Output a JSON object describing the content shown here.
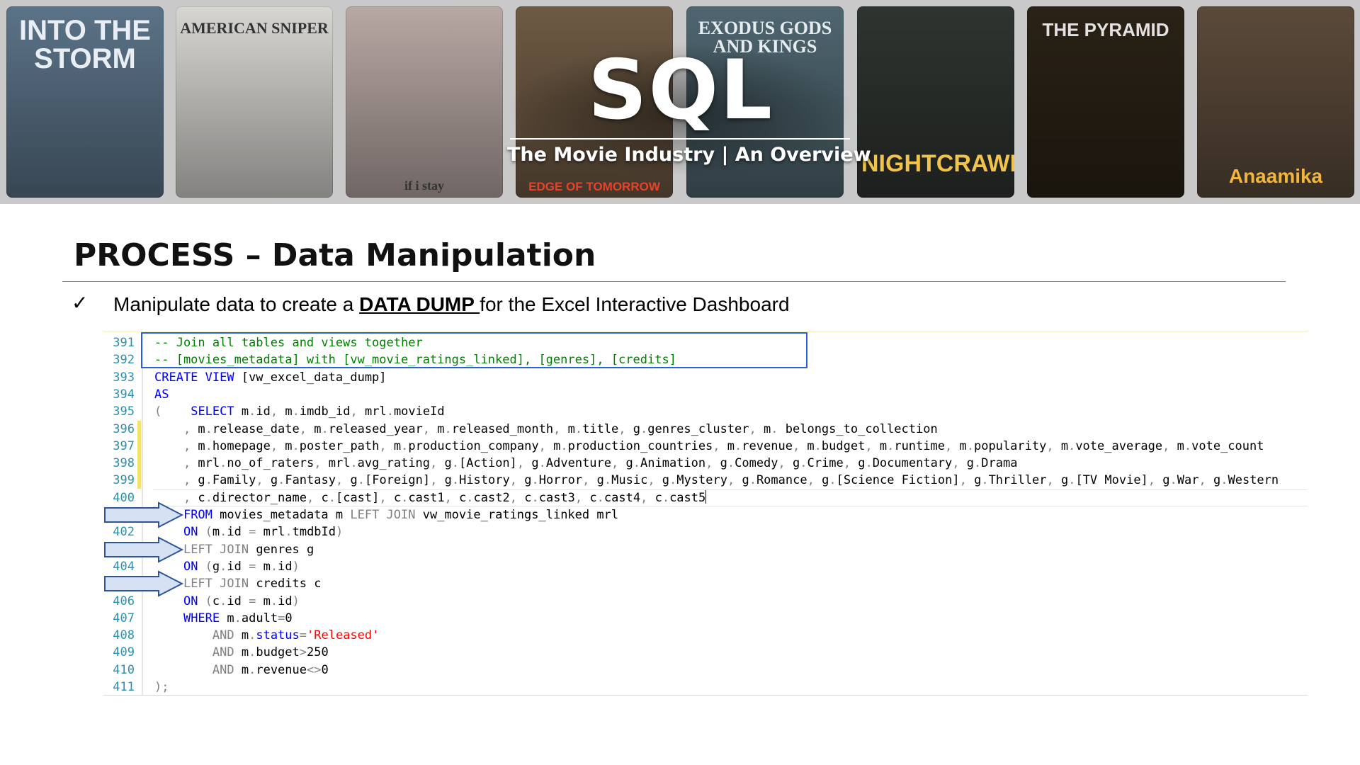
{
  "banner": {
    "title": "SQL",
    "subtitle": "The Movie Industry | An Overview",
    "posters": [
      {
        "name": "INTO THE STORM",
        "color": "#5b7388"
      },
      {
        "name": "AMERICAN SNIPER",
        "color": "#d8d6d2"
      },
      {
        "name": "if i stay",
        "color": "#b8a8a4"
      },
      {
        "name": "EDGE OF TOMORROW",
        "color": "#6e5a44"
      },
      {
        "name": "EXODUS GODS AND KINGS",
        "color": "#4f6670"
      },
      {
        "name": "NIGHTCRAWLER",
        "color": "#2f3430"
      },
      {
        "name": "THE PYRAMID",
        "color": "#2a2216"
      },
      {
        "name": "Anaamika",
        "color": "#5b4a3a"
      }
    ]
  },
  "slide": {
    "title": "PROCESS – Data Manipulation",
    "bullet_mark": "✓",
    "bullet_pre": "Manipulate data to create a ",
    "bullet_em": "DATA DUMP ",
    "bullet_post": "for the Excel Interactive Dashboard"
  },
  "code_lines": [
    {
      "n": "391",
      "seg": [
        [
          "-- Join all tables and views together",
          "cm"
        ]
      ]
    },
    {
      "n": "392",
      "seg": [
        [
          "-- [movies_metadata] with [vw_movie_ratings_linked], [genres], [credits]",
          "cm"
        ]
      ]
    },
    {
      "n": "393",
      "seg": [
        [
          "CREATE VIEW ",
          "k"
        ],
        [
          "[vw_excel_data_dump]",
          ""
        ]
      ]
    },
    {
      "n": "394",
      "seg": [
        [
          "AS",
          "k"
        ]
      ]
    },
    {
      "n": "395",
      "seg": [
        [
          "(",
          "gr"
        ],
        [
          "    ",
          ""
        ],
        [
          "SELECT ",
          "k"
        ],
        [
          "m",
          ""
        ],
        [
          ".",
          "gr"
        ],
        [
          "id",
          ""
        ],
        [
          ", ",
          "gr"
        ],
        [
          "m",
          ""
        ],
        [
          ".",
          "gr"
        ],
        [
          "imdb_id",
          ""
        ],
        [
          ", ",
          "gr"
        ],
        [
          "mrl",
          ""
        ],
        [
          ".",
          "gr"
        ],
        [
          "movieId",
          ""
        ]
      ]
    },
    {
      "n": "396",
      "seg": [
        [
          "    , ",
          "gr"
        ],
        [
          "m",
          ""
        ],
        [
          ".",
          "gr"
        ],
        [
          "release_date",
          ""
        ],
        [
          ", ",
          "gr"
        ],
        [
          "m",
          ""
        ],
        [
          ".",
          "gr"
        ],
        [
          "released_year",
          ""
        ],
        [
          ", ",
          "gr"
        ],
        [
          "m",
          ""
        ],
        [
          ".",
          "gr"
        ],
        [
          "released_month",
          ""
        ],
        [
          ", ",
          "gr"
        ],
        [
          "m",
          ""
        ],
        [
          ".",
          "gr"
        ],
        [
          "title",
          ""
        ],
        [
          ", ",
          "gr"
        ],
        [
          "g",
          ""
        ],
        [
          ".",
          "gr"
        ],
        [
          "genres_cluster",
          ""
        ],
        [
          ", ",
          "gr"
        ],
        [
          "m",
          ""
        ],
        [
          ". ",
          "gr"
        ],
        [
          "belongs_to_collection",
          ""
        ]
      ]
    },
    {
      "n": "397",
      "seg": [
        [
          "    , ",
          "gr"
        ],
        [
          "m",
          ""
        ],
        [
          ".",
          "gr"
        ],
        [
          "homepage",
          ""
        ],
        [
          ", ",
          "gr"
        ],
        [
          "m",
          ""
        ],
        [
          ".",
          "gr"
        ],
        [
          "poster_path",
          ""
        ],
        [
          ", ",
          "gr"
        ],
        [
          "m",
          ""
        ],
        [
          ".",
          "gr"
        ],
        [
          "production_company",
          ""
        ],
        [
          ", ",
          "gr"
        ],
        [
          "m",
          ""
        ],
        [
          ".",
          "gr"
        ],
        [
          "production_countries",
          ""
        ],
        [
          ", ",
          "gr"
        ],
        [
          "m",
          ""
        ],
        [
          ".",
          "gr"
        ],
        [
          "revenue",
          ""
        ],
        [
          ", ",
          "gr"
        ],
        [
          "m",
          ""
        ],
        [
          ".",
          "gr"
        ],
        [
          "budget",
          ""
        ],
        [
          ", ",
          "gr"
        ],
        [
          "m",
          ""
        ],
        [
          ".",
          "gr"
        ],
        [
          "runtime",
          ""
        ],
        [
          ", ",
          "gr"
        ],
        [
          "m",
          ""
        ],
        [
          ".",
          "gr"
        ],
        [
          "popularity",
          ""
        ],
        [
          ", ",
          "gr"
        ],
        [
          "m",
          ""
        ],
        [
          ".",
          "gr"
        ],
        [
          "vote_average",
          ""
        ],
        [
          ", ",
          "gr"
        ],
        [
          "m",
          ""
        ],
        [
          ".",
          "gr"
        ],
        [
          "vote_count",
          ""
        ]
      ]
    },
    {
      "n": "398",
      "seg": [
        [
          "    , ",
          "gr"
        ],
        [
          "mrl",
          ""
        ],
        [
          ".",
          "gr"
        ],
        [
          "no_of_raters",
          ""
        ],
        [
          ", ",
          "gr"
        ],
        [
          "mrl",
          ""
        ],
        [
          ".",
          "gr"
        ],
        [
          "avg_rating",
          ""
        ],
        [
          ", ",
          "gr"
        ],
        [
          "g",
          ""
        ],
        [
          ".",
          "gr"
        ],
        [
          "[Action]",
          ""
        ],
        [
          ", ",
          "gr"
        ],
        [
          "g",
          ""
        ],
        [
          ".",
          "gr"
        ],
        [
          "Adventure",
          ""
        ],
        [
          ", ",
          "gr"
        ],
        [
          "g",
          ""
        ],
        [
          ".",
          "gr"
        ],
        [
          "Animation",
          ""
        ],
        [
          ", ",
          "gr"
        ],
        [
          "g",
          ""
        ],
        [
          ".",
          "gr"
        ],
        [
          "Comedy",
          ""
        ],
        [
          ", ",
          "gr"
        ],
        [
          "g",
          ""
        ],
        [
          ".",
          "gr"
        ],
        [
          "Crime",
          ""
        ],
        [
          ", ",
          "gr"
        ],
        [
          "g",
          ""
        ],
        [
          ".",
          "gr"
        ],
        [
          "Documentary",
          ""
        ],
        [
          ", ",
          "gr"
        ],
        [
          "g",
          ""
        ],
        [
          ".",
          "gr"
        ],
        [
          "Drama",
          ""
        ]
      ]
    },
    {
      "n": "399",
      "seg": [
        [
          "    , ",
          "gr"
        ],
        [
          "g",
          ""
        ],
        [
          ".",
          "gr"
        ],
        [
          "Family",
          ""
        ],
        [
          ", ",
          "gr"
        ],
        [
          "g",
          ""
        ],
        [
          ".",
          "gr"
        ],
        [
          "Fantasy",
          ""
        ],
        [
          ", ",
          "gr"
        ],
        [
          "g",
          ""
        ],
        [
          ".",
          "gr"
        ],
        [
          "[Foreign]",
          ""
        ],
        [
          ", ",
          "gr"
        ],
        [
          "g",
          ""
        ],
        [
          ".",
          "gr"
        ],
        [
          "History",
          ""
        ],
        [
          ", ",
          "gr"
        ],
        [
          "g",
          ""
        ],
        [
          ".",
          "gr"
        ],
        [
          "Horror",
          ""
        ],
        [
          ", ",
          "gr"
        ],
        [
          "g",
          ""
        ],
        [
          ".",
          "gr"
        ],
        [
          "Music",
          ""
        ],
        [
          ", ",
          "gr"
        ],
        [
          "g",
          ""
        ],
        [
          ".",
          "gr"
        ],
        [
          "Mystery",
          ""
        ],
        [
          ", ",
          "gr"
        ],
        [
          "g",
          ""
        ],
        [
          ".",
          "gr"
        ],
        [
          "Romance",
          ""
        ],
        [
          ", ",
          "gr"
        ],
        [
          "g",
          ""
        ],
        [
          ".",
          "gr"
        ],
        [
          "[Science Fiction]",
          ""
        ],
        [
          ", ",
          "gr"
        ],
        [
          "g",
          ""
        ],
        [
          ".",
          "gr"
        ],
        [
          "Thriller",
          ""
        ],
        [
          ", ",
          "gr"
        ],
        [
          "g",
          ""
        ],
        [
          ".",
          "gr"
        ],
        [
          "[TV Movie]",
          ""
        ],
        [
          ", ",
          "gr"
        ],
        [
          "g",
          ""
        ],
        [
          ".",
          "gr"
        ],
        [
          "War",
          ""
        ],
        [
          ", ",
          "gr"
        ],
        [
          "g",
          ""
        ],
        [
          ".",
          "gr"
        ],
        [
          "Western",
          ""
        ]
      ]
    },
    {
      "n": "400",
      "seg": [
        [
          "    , ",
          "gr"
        ],
        [
          "c",
          ""
        ],
        [
          ".",
          "gr"
        ],
        [
          "director_name",
          ""
        ],
        [
          ", ",
          "gr"
        ],
        [
          "c",
          ""
        ],
        [
          ".",
          "gr"
        ],
        [
          "[cast]",
          ""
        ],
        [
          ", ",
          "gr"
        ],
        [
          "c",
          ""
        ],
        [
          ".",
          "gr"
        ],
        [
          "cast1",
          ""
        ],
        [
          ", ",
          "gr"
        ],
        [
          "c",
          ""
        ],
        [
          ".",
          "gr"
        ],
        [
          "cast2",
          ""
        ],
        [
          ", ",
          "gr"
        ],
        [
          "c",
          ""
        ],
        [
          ".",
          "gr"
        ],
        [
          "cast3",
          ""
        ],
        [
          ", ",
          "gr"
        ],
        [
          "c",
          ""
        ],
        [
          ".",
          "gr"
        ],
        [
          "cast4",
          ""
        ],
        [
          ", ",
          "gr"
        ],
        [
          "c",
          ""
        ],
        [
          ".",
          "gr"
        ],
        [
          "cast5",
          ""
        ]
      ]
    },
    {
      "n": "",
      "seg": [
        [
          "    ",
          ""
        ],
        [
          "FROM ",
          "k"
        ],
        [
          "movies_metadata m ",
          ""
        ],
        [
          "LEFT JOIN ",
          "gr"
        ],
        [
          "vw_movie_ratings_linked mrl",
          ""
        ]
      ]
    },
    {
      "n": "402",
      "seg": [
        [
          "    ",
          ""
        ],
        [
          "ON ",
          "k"
        ],
        [
          "(",
          "gr"
        ],
        [
          "m",
          ""
        ],
        [
          ".",
          "gr"
        ],
        [
          "id ",
          ""
        ],
        [
          "= ",
          "gr"
        ],
        [
          "mrl",
          ""
        ],
        [
          ".",
          "gr"
        ],
        [
          "tmdbId",
          ""
        ],
        [
          ")",
          "gr"
        ]
      ]
    },
    {
      "n": "",
      "seg": [
        [
          "    ",
          ""
        ],
        [
          "LEFT JOIN ",
          "gr"
        ],
        [
          "genres g",
          ""
        ]
      ]
    },
    {
      "n": "404",
      "seg": [
        [
          "    ",
          ""
        ],
        [
          "ON ",
          "k"
        ],
        [
          "(",
          "gr"
        ],
        [
          "g",
          ""
        ],
        [
          ".",
          "gr"
        ],
        [
          "id ",
          ""
        ],
        [
          "= ",
          "gr"
        ],
        [
          "m",
          ""
        ],
        [
          ".",
          "gr"
        ],
        [
          "id",
          ""
        ],
        [
          ")",
          "gr"
        ]
      ]
    },
    {
      "n": "",
      "seg": [
        [
          "    ",
          ""
        ],
        [
          "LEFT JOIN ",
          "gr"
        ],
        [
          "credits c",
          ""
        ]
      ]
    },
    {
      "n": "406",
      "seg": [
        [
          "    ",
          ""
        ],
        [
          "ON ",
          "k"
        ],
        [
          "(",
          "gr"
        ],
        [
          "c",
          ""
        ],
        [
          ".",
          "gr"
        ],
        [
          "id ",
          ""
        ],
        [
          "= ",
          "gr"
        ],
        [
          "m",
          ""
        ],
        [
          ".",
          "gr"
        ],
        [
          "id",
          ""
        ],
        [
          ")",
          "gr"
        ]
      ]
    },
    {
      "n": "407",
      "seg": [
        [
          "    ",
          ""
        ],
        [
          "WHERE ",
          "k"
        ],
        [
          "m",
          ""
        ],
        [
          ".",
          "gr"
        ],
        [
          "adult",
          ""
        ],
        [
          "=",
          "gr"
        ],
        [
          "0",
          ""
        ]
      ]
    },
    {
      "n": "408",
      "seg": [
        [
          "        ",
          ""
        ],
        [
          "AND ",
          "gr"
        ],
        [
          "m",
          ""
        ],
        [
          ".",
          "gr"
        ],
        [
          "status",
          "k"
        ],
        [
          "=",
          "gr"
        ],
        [
          "'Released'",
          "st"
        ]
      ]
    },
    {
      "n": "409",
      "seg": [
        [
          "        ",
          ""
        ],
        [
          "AND ",
          "gr"
        ],
        [
          "m",
          ""
        ],
        [
          ".",
          "gr"
        ],
        [
          "budget",
          ""
        ],
        [
          ">",
          "gr"
        ],
        [
          "250",
          ""
        ]
      ]
    },
    {
      "n": "410",
      "seg": [
        [
          "        ",
          ""
        ],
        [
          "AND ",
          "gr"
        ],
        [
          "m",
          ""
        ],
        [
          ".",
          "gr"
        ],
        [
          "revenue",
          ""
        ],
        [
          "<>",
          "gr"
        ],
        [
          "0",
          ""
        ]
      ]
    },
    {
      "n": "411",
      "seg": [
        [
          ")",
          "gr"
        ],
        [
          ";",
          "gr"
        ]
      ]
    }
  ],
  "colors": {
    "keyword": "#0000ff",
    "comment": "#008000",
    "string": "#ff0000",
    "operator": "#808080",
    "line_number": "#2b91af",
    "highlight_box": "#2b61d6",
    "arrow_fill": "#d4e2f4",
    "arrow_stroke": "#2f5597"
  }
}
